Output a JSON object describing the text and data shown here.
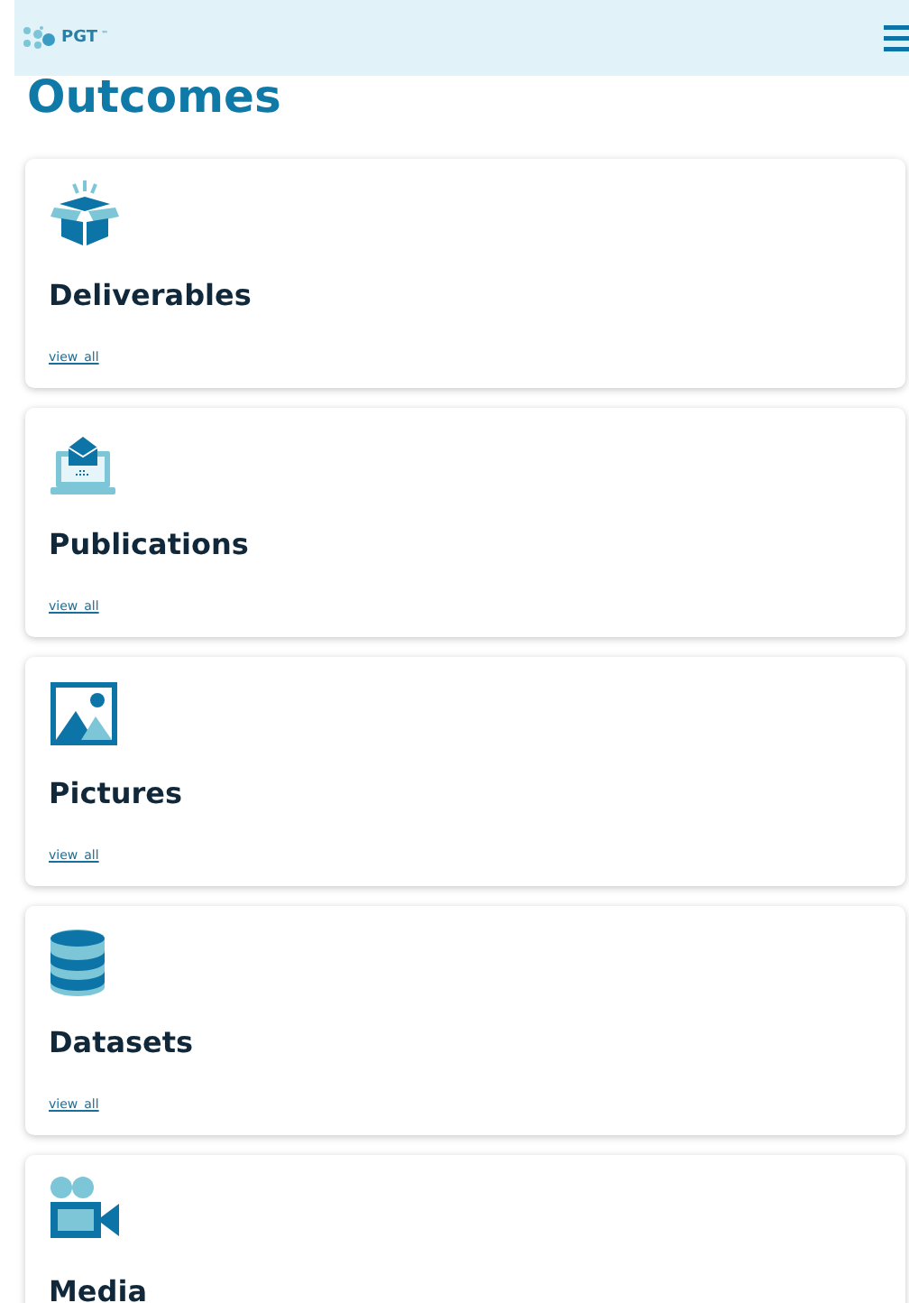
{
  "header": {
    "logo_text": "PGT",
    "logo_mark": "™"
  },
  "title": "Outcomes",
  "outcomes": [
    {
      "kind": "box",
      "title": "Deliverables",
      "link": "view_all"
    },
    {
      "kind": "laptop",
      "title": "Publications",
      "link": "view_all"
    },
    {
      "kind": "picture",
      "title": "Pictures",
      "link": "view_all"
    },
    {
      "kind": "database",
      "title": "Datasets",
      "link": "view_all"
    },
    {
      "kind": "camera",
      "title": "Media"
    }
  ]
}
